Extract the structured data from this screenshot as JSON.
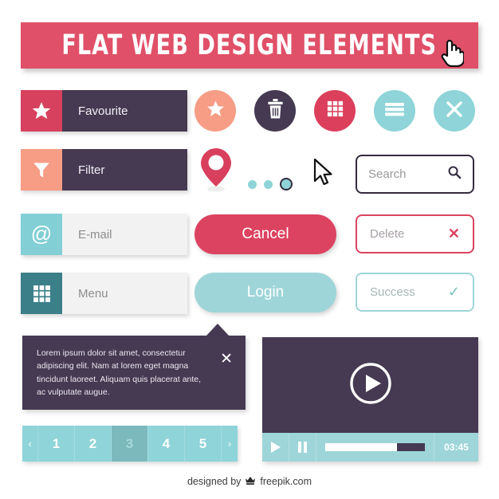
{
  "header": {
    "title": "FLAT WEB DESIGN ELEMENTS",
    "bg_color": "#e05068",
    "cursor_icon": "hand-pointer-cursor-icon"
  },
  "labeled_buttons": [
    {
      "label": "Favourite",
      "icon": "star-icon",
      "icon_color": "#d8415e",
      "style": "dark"
    },
    {
      "label": "Filter",
      "icon": "filter-icon",
      "icon_color": "#f79d85",
      "style": "dark"
    },
    {
      "label": "E-mail",
      "icon": "at-sign-icon",
      "icon_color": "#82cfd5",
      "style": "light"
    },
    {
      "label": "Menu",
      "icon": "grid-icon",
      "icon_color": "#3b7f89",
      "style": "light"
    }
  ],
  "circle_icons": [
    {
      "name": "star-icon",
      "color": "#f79d85"
    },
    {
      "name": "trash-icon",
      "color": "#453a52"
    },
    {
      "name": "grid-icon",
      "color": "#dc3f5c"
    },
    {
      "name": "hamburger-icon",
      "color": "#8ed4d8"
    },
    {
      "name": "close-icon",
      "color": "#8ed4d8"
    }
  ],
  "misc": {
    "map_pin_icon": "map-pin-icon",
    "arrow_cursor_icon": "arrow-cursor-icon",
    "dots": {
      "count": 3,
      "active_index": 2,
      "color": "#8ed4d8",
      "ring_color": "#342b3f"
    }
  },
  "search": {
    "placeholder": "Search",
    "icon": "magnifier-icon",
    "border_color": "#342b3f"
  },
  "actions": {
    "cancel_label": "Cancel",
    "cancel_color": "#dc4361",
    "login_label": "Login",
    "login_color": "#9ed5d8",
    "delete_label": "Delete",
    "delete_mark": "✕",
    "delete_color": "#dc4361",
    "success_label": "Success",
    "success_mark": "✓",
    "success_color": "#9ed5d8"
  },
  "tooltip": {
    "text": "Lorem ipsum dolor sit amet, consectetur adipiscing elit. Nam at lorem eget magna tincidunt laoreet. Aliquam quis placerat ante, ac vulputate augue.",
    "close_mark": "✕",
    "bg_color": "#453a52"
  },
  "pagination": {
    "prev_label": "‹",
    "next_label": "›",
    "pages": [
      "1",
      "2",
      "3",
      "4",
      "5"
    ],
    "current_page": "3",
    "color": "#8ed4d8",
    "active_color": "#7cb9bd"
  },
  "video": {
    "play_overlay_icon": "play-circle-icon",
    "play_icon": "play-icon",
    "pause_icon": "pause-icon",
    "time": "03:45",
    "progress_percent": 72,
    "screen_color": "#453a52",
    "bar_color": "#9ed5d8"
  },
  "footer": {
    "prefix": "designed by",
    "brand": "freepik.com",
    "icon": "freepik-crown-icon"
  }
}
